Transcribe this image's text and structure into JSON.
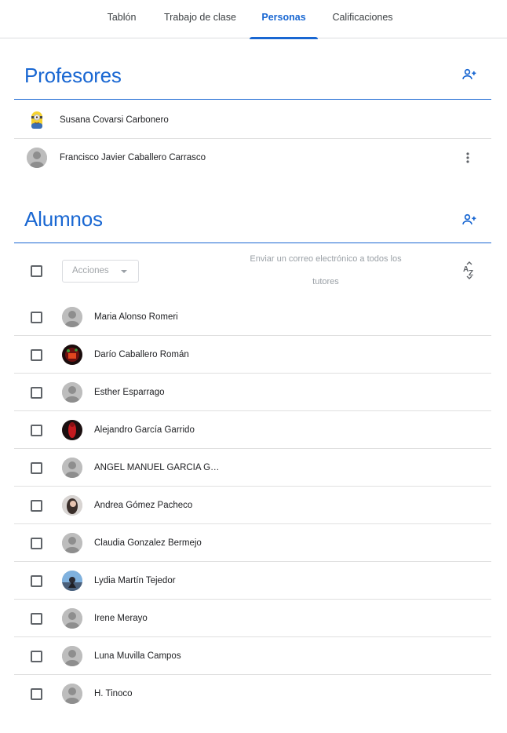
{
  "tabs": [
    {
      "label": "Tablón"
    },
    {
      "label": "Trabajo de clase"
    },
    {
      "label": "Personas"
    },
    {
      "label": "Calificaciones"
    }
  ],
  "active_tab": "Personas",
  "teachers": {
    "title": "Profesores",
    "add_icon": "person-add-icon",
    "items": [
      {
        "name": "Susana Covarsi Carbonero",
        "avatar": "minion-photo"
      },
      {
        "name": "Francisco Javier Caballero Carrasco",
        "avatar": "default-avatar"
      }
    ]
  },
  "students": {
    "title": "Alumnos",
    "add_icon": "person-add-icon",
    "actions_label": "Acciones",
    "email_all_line1": "Enviar un correo electrónico a todos los",
    "email_all_line2": "tutores",
    "sort_icon": "sort-az-icon",
    "items": [
      {
        "name": "Maria Alonso Romeri",
        "avatar": "default-avatar"
      },
      {
        "name": "Darío Caballero Román",
        "avatar": "photo-dark-red"
      },
      {
        "name": "Esther Esparrago",
        "avatar": "default-avatar"
      },
      {
        "name": "Alejandro García Garrido",
        "avatar": "photo-red-figure"
      },
      {
        "name": "ANGEL MANUEL GARCIA G…",
        "avatar": "default-avatar"
      },
      {
        "name": "Andrea Gómez Pacheco",
        "avatar": "photo-portrait"
      },
      {
        "name": "Claudia Gonzalez Bermejo",
        "avatar": "default-avatar"
      },
      {
        "name": "Lydia Martín Tejedor",
        "avatar": "photo-sky"
      },
      {
        "name": "Irene Merayo",
        "avatar": "default-avatar"
      },
      {
        "name": "Luna Muvilla Campos",
        "avatar": "default-avatar"
      },
      {
        "name": "H. Tinoco",
        "avatar": "default-avatar"
      }
    ]
  },
  "colors": {
    "accent": "#1967d2",
    "text": "#202124",
    "divider": "#e0e0e0"
  }
}
